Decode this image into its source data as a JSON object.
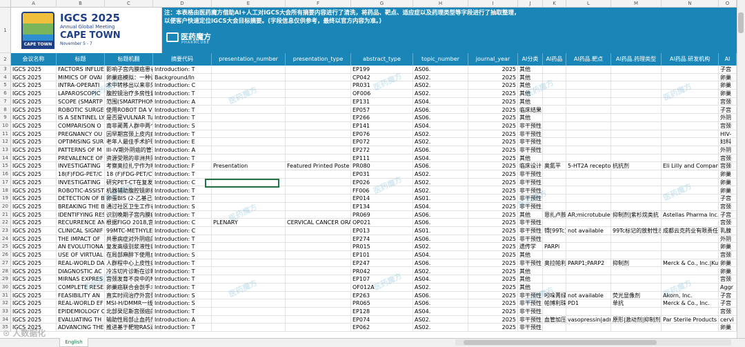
{
  "columns": {
    "letters": [
      "A",
      "B",
      "C",
      "D",
      "E",
      "F",
      "G",
      "H",
      "I",
      "J",
      "K",
      "L",
      "M",
      "N",
      "O"
    ],
    "headers": [
      "会议名称",
      "标题",
      "标题机翻",
      "摘要代码",
      "presentation_number",
      "presentation_type",
      "abstract_type",
      "topic_number",
      "journal_year",
      "AI分类",
      "AI药品",
      "AI药品.靶点",
      "AI药品.药理类型",
      "AI药品.研发机构",
      "AI"
    ]
  },
  "banner": {
    "note_line1": "注：本表格由医药魔方借助AI+人工对IGCS大会所有摘要内容进行了清洗，将药品、靶点、适应症以及药理类型等字段进行了抽取整理，",
    "note_line2": "以便客户快速定位IGCS大会目标摘要。(字段信息仅供参考，最终以官方内容为准。)",
    "brand_name": "医药魔方",
    "brand_en": "PHARMCUBE",
    "logo_title": "IGCS 2025",
    "logo_sub": "Annual Global Meeting",
    "logo_city": "CAPE TOWN",
    "logo_date": "November 5 - 7",
    "logo_flag": "CAPE TOWN"
  },
  "watermark": "医药魔方",
  "corner_watermark": "⊙ 人数据化",
  "sheet_tab": "English",
  "rows": [
    {
      "n": "3",
      "c": [
        "IGCS 2025",
        "FACTORS INFLUE",
        "影响子宫内膜癌患者",
        "Introduction: T",
        "",
        "",
        "EP199",
        "AS06.",
        "2025",
        "其他",
        "",
        "",
        "",
        "",
        "子宫"
      ]
    },
    {
      "n": "4",
      "c": [
        "IGCS 2025",
        "MIMICS OF OVAI",
        "卵巢癌模拟：一种诊断",
        "Background/In",
        "",
        "",
        "CP042",
        "AS02.",
        "2025",
        "其他",
        "",
        "",
        "",
        "",
        "卵巢"
      ]
    },
    {
      "n": "5",
      "c": [
        "IGCS 2025",
        "INTRA-OPERATI",
        "术中转移出以来非外",
        "Introduction: C",
        "",
        "",
        "PR031",
        "AS02.",
        "2025",
        "其他",
        "",
        "",
        "",
        "",
        "卵巢"
      ]
    },
    {
      "n": "6",
      "c": [
        "IGCS 2025",
        "LAPAROSCOPIC",
        "腹腔镜治疗多房性囊",
        "Introduction: T",
        "",
        "",
        "OF006",
        "AS02.",
        "2025",
        "其他",
        "",
        "",
        "",
        "",
        "卵巢"
      ]
    },
    {
      "n": "7",
      "c": [
        "IGCS 2025",
        "SCOPE (SMARTP",
        "范围(SMARTPHONE",
        "Introduction: A",
        "",
        "",
        "EP131",
        "AS04.",
        "2025",
        "其他",
        "",
        "",
        "",
        "",
        "宫颈"
      ]
    },
    {
      "n": "8",
      "c": [
        "IGCS 2025",
        "ROBOTIC SURGE",
        "使用ROBOT DA VINC",
        "Introduction: T",
        "",
        "",
        "EP057",
        "AS06.",
        "2025",
        "临床结果",
        "",
        "",
        "",
        "",
        "子宫"
      ]
    },
    {
      "n": "9",
      "c": [
        "IGCS 2025",
        "IS A SENTINEL LY",
        "是否是VULNAR Tum",
        "Introduction: T",
        "",
        "",
        "EP266",
        "AS06.",
        "2025",
        "其他",
        "",
        "",
        "",
        "",
        "外阴"
      ]
    },
    {
      "n": "10",
      "c": [
        "IGCS 2025",
        "COMPARISON O",
        "南非蔺菁人群中两个",
        "Introduction: S",
        "",
        "",
        "EP141",
        "AS04.",
        "2025",
        "非干预性",
        "",
        "",
        "",
        "",
        "宫颈"
      ]
    },
    {
      "n": "11",
      "c": [
        "IGCS 2025",
        "PREGNANCY OU",
        "因早期宫颈上皮内病",
        "Introduction: T",
        "",
        "",
        "EP076",
        "AS02.",
        "2025",
        "非干预性",
        "",
        "",
        "",
        "",
        "HIV-"
      ]
    },
    {
      "n": "12",
      "c": [
        "IGCS 2025",
        "OPTIMISING SUR",
        "老年人最佳手术护理",
        "Introduction: E",
        "",
        "",
        "EP072",
        "AS02.",
        "2025",
        "非干预性",
        "",
        "",
        "",
        "",
        "妇科"
      ]
    },
    {
      "n": "13",
      "c": [
        "IGCS 2025",
        "PATTERNS OF M",
        "III-IV期外阴癌的管理",
        "Introduction: A",
        "",
        "",
        "EP272",
        "AS06.",
        "2025",
        "非干预性",
        "",
        "",
        "",
        "",
        "外阴"
      ]
    },
    {
      "n": "14",
      "c": [
        "IGCS 2025",
        "PREVALENCE OF",
        "资源受限的非洲共同",
        "Introduction: T",
        "",
        "",
        "EP111",
        "AS04.",
        "2025",
        "其他",
        "",
        "",
        "",
        "",
        "宫颈"
      ]
    },
    {
      "n": "15",
      "c": [
        "IGCS 2025",
        "INVESTIGATING",
        "考察奥拉扎宁作为晚期",
        "Introduction: F",
        "Presentation",
        "Featured Printed Poste",
        "PR080",
        "AS06.",
        "2025",
        "临床设计",
        "奥氮平",
        "5-HT2A recepto",
        "抗抗剂",
        "Eli Lilly and Compan",
        "宫颈"
      ]
    },
    {
      "n": "16",
      "c": [
        "IGCS 2025",
        "18(F)FDG-PET/C",
        "18 (F)FDG-PET/CT在",
        "Introduction: T",
        "",
        "",
        "EP031",
        "AS02.",
        "2025",
        "非干预性",
        "",
        "",
        "",
        "",
        "卵巢"
      ]
    },
    {
      "n": "17",
      "c": [
        "IGCS 2025",
        "INVESTIGATING",
        "研究PET-CT在复发性",
        "Introduction: C",
        "",
        "",
        "EP026",
        "AS02.",
        "2025",
        "非干预性",
        "",
        "",
        "",
        "",
        "卵巢"
      ]
    },
    {
      "n": "18",
      "c": [
        "IGCS 2025",
        "ROBOTIC-ASSIST",
        "机器辅助腹腔镜卵巢",
        "Introduction: T",
        "",
        "",
        "FF006",
        "AS02.",
        "2025",
        "非干预性",
        "",
        "",
        "",
        "",
        "卵巢"
      ]
    },
    {
      "n": "19",
      "c": [
        "IGCS 2025",
        "DETECTION OF B",
        "卵蛋BIS (2-乙基己基",
        "Introduction: T",
        "",
        "",
        "EP014",
        "AS01.",
        "2025",
        "非干预性",
        "",
        "",
        "",
        "",
        "子宫"
      ]
    },
    {
      "n": "20",
      "c": [
        "IGCS 2025",
        "BREAKING THE B",
        "通过社区卫生工作者",
        "Introduction: S",
        "",
        "",
        "EP134",
        "AS04.",
        "2025",
        "非干预性",
        "",
        "",
        "",
        "",
        "宫颈"
      ]
    },
    {
      "n": "21",
      "c": [
        "IGCS 2025",
        "IDENTIFYING RES",
        "识别晚期子宫内膜癌",
        "Introduction: T",
        "",
        "",
        "PR069",
        "AS06.",
        "2025",
        "其他",
        "恩扎卢胺",
        "AR;microtubule",
        "抑制剂|紫杉烷类抗",
        "Astellas Pharma Inc.|",
        "子宫"
      ]
    },
    {
      "n": "22",
      "c": [
        "IGCS 2025",
        "RECURRENCE AN",
        "根据FIGO 2018,宫颈",
        "Introduction: C",
        "PLENARY",
        "CERVICAL CANCER ORA",
        "OP021",
        "AS06.",
        "2025",
        "非干预性",
        "",
        "",
        "",
        "",
        "宫颈"
      ]
    },
    {
      "n": "23",
      "c": [
        "IGCS 2025",
        "CLINICAL SIGNIF",
        "99MTC-METHYLE D",
        "Introduction: C",
        "",
        "",
        "EP013",
        "AS01.",
        "2025",
        "非干预性",
        "锝[99Tc]",
        "not available",
        "99Tc标记的放射性示",
        "成都云克药业有限责任",
        "乳腺"
      ]
    },
    {
      "n": "24",
      "c": [
        "IGCS 2025",
        "THE IMPACT OF",
        "共患病症对外阴癌的",
        "Introduction: T",
        "",
        "",
        "EP274",
        "AS06.",
        "2025",
        "非干预性",
        "",
        "",
        "",
        "",
        "外阴"
      ]
    },
    {
      "n": "25",
      "c": [
        "IGCS 2025",
        "AN EVOLUTIONA",
        "复发高级别浆液性卵巢",
        "Introduction: T",
        "",
        "",
        "PR015",
        "AS02.",
        "2025",
        "遗传学",
        "PARPi",
        "",
        "",
        "",
        "卵巢"
      ]
    },
    {
      "n": "26",
      "c": [
        "IGCS 2025",
        "USE OF VIRTUAL",
        "在局部麻醉下使用虚拟",
        "Introduction: S",
        "",
        "",
        "EP101",
        "AS04.",
        "2025",
        "其他",
        "",
        "",
        "",
        "",
        "宫颈"
      ]
    },
    {
      "n": "27",
      "c": [
        "IGCS 2025",
        "REAL-WORLD DA",
        "人群程中心上皮性卵巢",
        "Introduction: T",
        "",
        "",
        "EP247",
        "AS06.",
        "2025",
        "非干预性",
        "奥拉帕利",
        "PARP1;PARP2",
        "抑制剂",
        "Merck & Co., Inc.|Ku",
        "卵巢"
      ]
    },
    {
      "n": "28",
      "c": [
        "IGCS 2025",
        "DIAGNOSTIC AC",
        "冷冻切片诊断在诊断",
        "Introduction: T",
        "",
        "",
        "PR042",
        "AS02.",
        "2025",
        "其他",
        "",
        "",
        "",
        "",
        "卵巢"
      ]
    },
    {
      "n": "29",
      "c": [
        "IGCS 2025",
        "MIRNAS EXPRES",
        "宫颈发育不良中的MI",
        "Introduction: T",
        "",
        "",
        "EP107",
        "AS04.",
        "2025",
        "其他",
        "",
        "",
        "",
        "",
        "宫颈"
      ]
    },
    {
      "n": "30",
      "c": [
        "IGCS 2025",
        "COMPLETE RESE",
        "卵巢癌联合会剖手术",
        "Introduction: T",
        "",
        "",
        "OF012A",
        "AS02.",
        "2025",
        "其他",
        "",
        "",
        "",
        "",
        "Aggr"
      ]
    },
    {
      "n": "31",
      "c": [
        "IGCS 2025",
        "FEASIBILITY AN",
        "直实时间治疗外宫颈",
        "Introduction: S",
        "",
        "",
        "EP263",
        "AS06.",
        "2025",
        "非干预性",
        "吲哚菁绿",
        "not available",
        "荧光显像剂",
        "Akorn, Inc.",
        "子宫"
      ]
    },
    {
      "n": "32",
      "c": [
        "IGCS 2025",
        "REAL-WORLD EF",
        "MSI-H/DMMR一线晚",
        "Introduction: S",
        "",
        "",
        "PR065",
        "AS06.",
        "2025",
        "非干预性",
        "帕博利珠",
        "PD1",
        "单抗",
        "Merck & Co., Inc.",
        "子宫"
      ]
    },
    {
      "n": "33",
      "c": [
        "IGCS 2025",
        "EPIDEMIOLOGY C",
        "北部癸尼斯宫颈癌的",
        "Introduction: T",
        "",
        "",
        "EP128",
        "AS04.",
        "2025",
        "非干预性",
        "",
        "",
        "",
        "",
        "宫颈"
      ]
    },
    {
      "n": "34",
      "c": [
        "IGCS 2025",
        "EVALUATING TH",
        "输助性局部止血药剂",
        "Introduction: A",
        "",
        "",
        "EP074",
        "AS02.",
        "2025",
        "非干预性",
        "血管加压",
        "vasopressin|adr",
        "原形|激动剂|抑制剂",
        "Par Sterile Products",
        "cervi"
      ]
    },
    {
      "n": "35",
      "c": [
        "IGCS 2025",
        "ADVANCING THE",
        "推进基于靶物RAS通",
        "Introduction: T",
        "",
        "",
        "EP062",
        "AS02.",
        "2025",
        "非干预性",
        "",
        "",
        "",
        "",
        "卵巢"
      ]
    }
  ]
}
